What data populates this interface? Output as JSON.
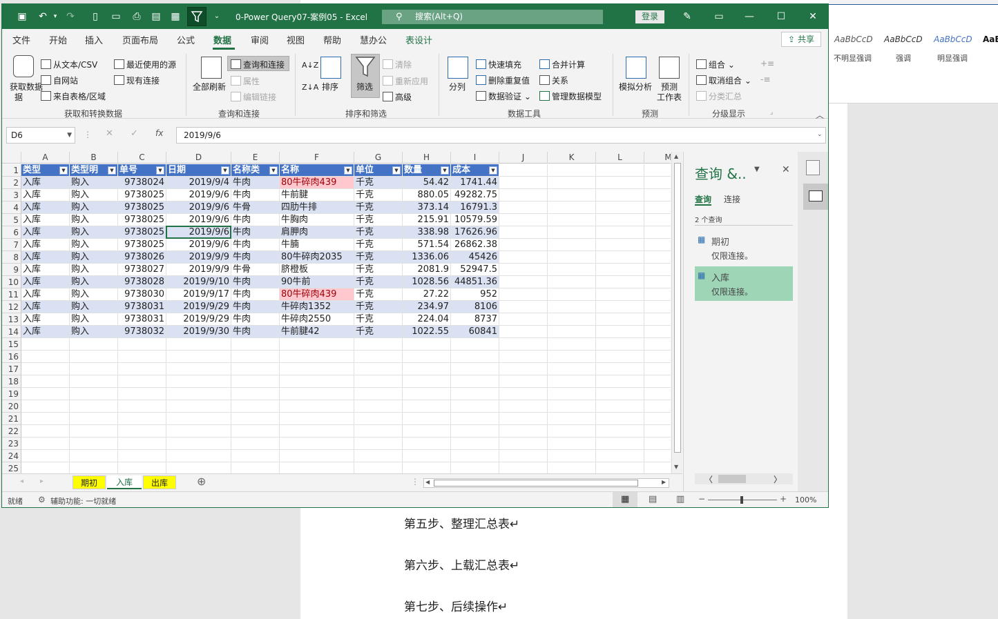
{
  "word": {
    "styles": [
      {
        "sample": "AaBbCcD",
        "label": "不明显强调",
        "color": "#555555"
      },
      {
        "sample": "AaBbCcD",
        "label": "强调",
        "color": "#333333"
      },
      {
        "sample": "AaBbCcD",
        "label": "明显强调",
        "color": "#4472c4"
      },
      {
        "sample": "AaB",
        "label": "",
        "color": "#111111"
      }
    ],
    "lines": [
      "第五步、整理汇总表↵",
      "第六步、上载汇总表↵",
      "第七步、后续操作↵"
    ]
  },
  "titlebar": {
    "title": "0-Power Query07-案例05  -  Excel",
    "search_placeholder": "搜索(Alt+Q)",
    "login": "登录"
  },
  "tabs": [
    "文件",
    "开始",
    "插入",
    "页面布局",
    "公式",
    "数据",
    "审阅",
    "视图",
    "帮助",
    "慧办公",
    "表设计"
  ],
  "active_tab": "数据",
  "share": "共享",
  "ribbon": {
    "get_data": "获取数据",
    "get_data2": "据",
    "from_text": "从文本/CSV",
    "from_web": "自网站",
    "from_table": "来自表格/区域",
    "recent": "最近使用的源",
    "existing": "现有连接",
    "group1": "获取和转换数据",
    "refresh_all": "全部刷新",
    "queries_conn": "查询和连接",
    "properties": "属性",
    "edit_links": "编辑链接",
    "group2": "查询和连接",
    "sort": "排序",
    "filter": "筛选",
    "clear": "清除",
    "reapply": "重新应用",
    "advanced": "高级",
    "group3": "排序和筛选",
    "split": "分列",
    "flash_fill": "快速填充",
    "remove_dup": "删除重复值",
    "validation": "数据验证",
    "consolidate": "合并计算",
    "relations": "关系",
    "manage_model": "管理数据模型",
    "group4": "数据工具",
    "whatif": "模拟分析",
    "forecast": "预测",
    "forecast2": "工作表",
    "group5": "预测",
    "group_btn": "组合",
    "ungroup": "取消组合",
    "subtotal": "分类汇总",
    "group6": "分级显示"
  },
  "formula": {
    "namebox": "D6",
    "fx": "fx",
    "value": "2019/9/6"
  },
  "columns": [
    "A",
    "B",
    "C",
    "D",
    "E",
    "F",
    "G",
    "H",
    "I",
    "J",
    "K",
    "L",
    "M"
  ],
  "table": {
    "headers": [
      "类型",
      "类型明",
      "单号",
      "日期",
      "名称类",
      "名称",
      "单位",
      "数量",
      "成本"
    ],
    "rows": [
      [
        "入库",
        "购入",
        "9738024",
        "2019/9/4",
        "牛肉",
        "80牛碎肉439",
        "千克",
        "54.42",
        "1741.44"
      ],
      [
        "入库",
        "购入",
        "9738025",
        "2019/9/6",
        "牛肉",
        "牛前腱",
        "千克",
        "880.05",
        "49282.75"
      ],
      [
        "入库",
        "购入",
        "9738025",
        "2019/9/6",
        "牛骨",
        "四肋牛排",
        "千克",
        "373.14",
        "16791.3"
      ],
      [
        "入库",
        "购入",
        "9738025",
        "2019/9/6",
        "牛肉",
        "牛胸肉",
        "千克",
        "215.91",
        "10579.59"
      ],
      [
        "入库",
        "购入",
        "9738025",
        "2019/9/6",
        "牛肉",
        "肩胛肉",
        "千克",
        "338.98",
        "17626.96"
      ],
      [
        "入库",
        "购入",
        "9738025",
        "2019/9/6",
        "牛肉",
        "牛腩",
        "千克",
        "571.54",
        "26862.38"
      ],
      [
        "入库",
        "购入",
        "9738026",
        "2019/9/9",
        "牛肉",
        "80牛碎肉2035",
        "千克",
        "1336.06",
        "45426"
      ],
      [
        "入库",
        "购入",
        "9738027",
        "2019/9/9",
        "牛骨",
        "脐橙板",
        "千克",
        "2081.9",
        "52947.5"
      ],
      [
        "入库",
        "购入",
        "9738028",
        "2019/9/10",
        "牛肉",
        "90牛前",
        "千克",
        "1028.56",
        "44851.36"
      ],
      [
        "入库",
        "购入",
        "9738030",
        "2019/9/17",
        "牛肉",
        "80牛碎肉439",
        "千克",
        "27.22",
        "952"
      ],
      [
        "入库",
        "购入",
        "9738031",
        "2019/9/29",
        "牛肉",
        "牛碎肉1352",
        "千克",
        "234.97",
        "8106"
      ],
      [
        "入库",
        "购入",
        "9738031",
        "2019/9/29",
        "牛肉",
        "牛碎肉2550",
        "千克",
        "224.04",
        "8737"
      ],
      [
        "入库",
        "购入",
        "9738032",
        "2019/9/30",
        "牛肉",
        "牛前腱42",
        "千克",
        "1022.55",
        "60841"
      ]
    ],
    "highlight_rows": [
      0,
      9
    ]
  },
  "row_numbers": [
    "1",
    "2",
    "3",
    "4",
    "5",
    "6",
    "7",
    "8",
    "9",
    "10",
    "11",
    "12",
    "13",
    "14",
    "15",
    "16",
    "17",
    "18",
    "19",
    "20",
    "21",
    "22",
    "23",
    "24",
    "25"
  ],
  "sheets": [
    "期初",
    "入库",
    "出库"
  ],
  "active_sheet": "入库",
  "query_panel": {
    "title": "查询 &..",
    "tab_query": "查询",
    "tab_conn": "连接",
    "count": "2 个查询",
    "items": [
      {
        "name": "期初",
        "desc": "仅限连接。"
      },
      {
        "name": "入库",
        "desc": "仅限连接。"
      }
    ]
  },
  "status": {
    "ready": "就绪",
    "accessibility": "辅助功能: 一切就绪",
    "zoom": "100%"
  },
  "colors": {
    "excel_green": "#217346",
    "table_header": "#4472c4",
    "band": "#d9e1f2",
    "highlight": "#ffc7ce",
    "query_selected": "#9fd5b7"
  }
}
